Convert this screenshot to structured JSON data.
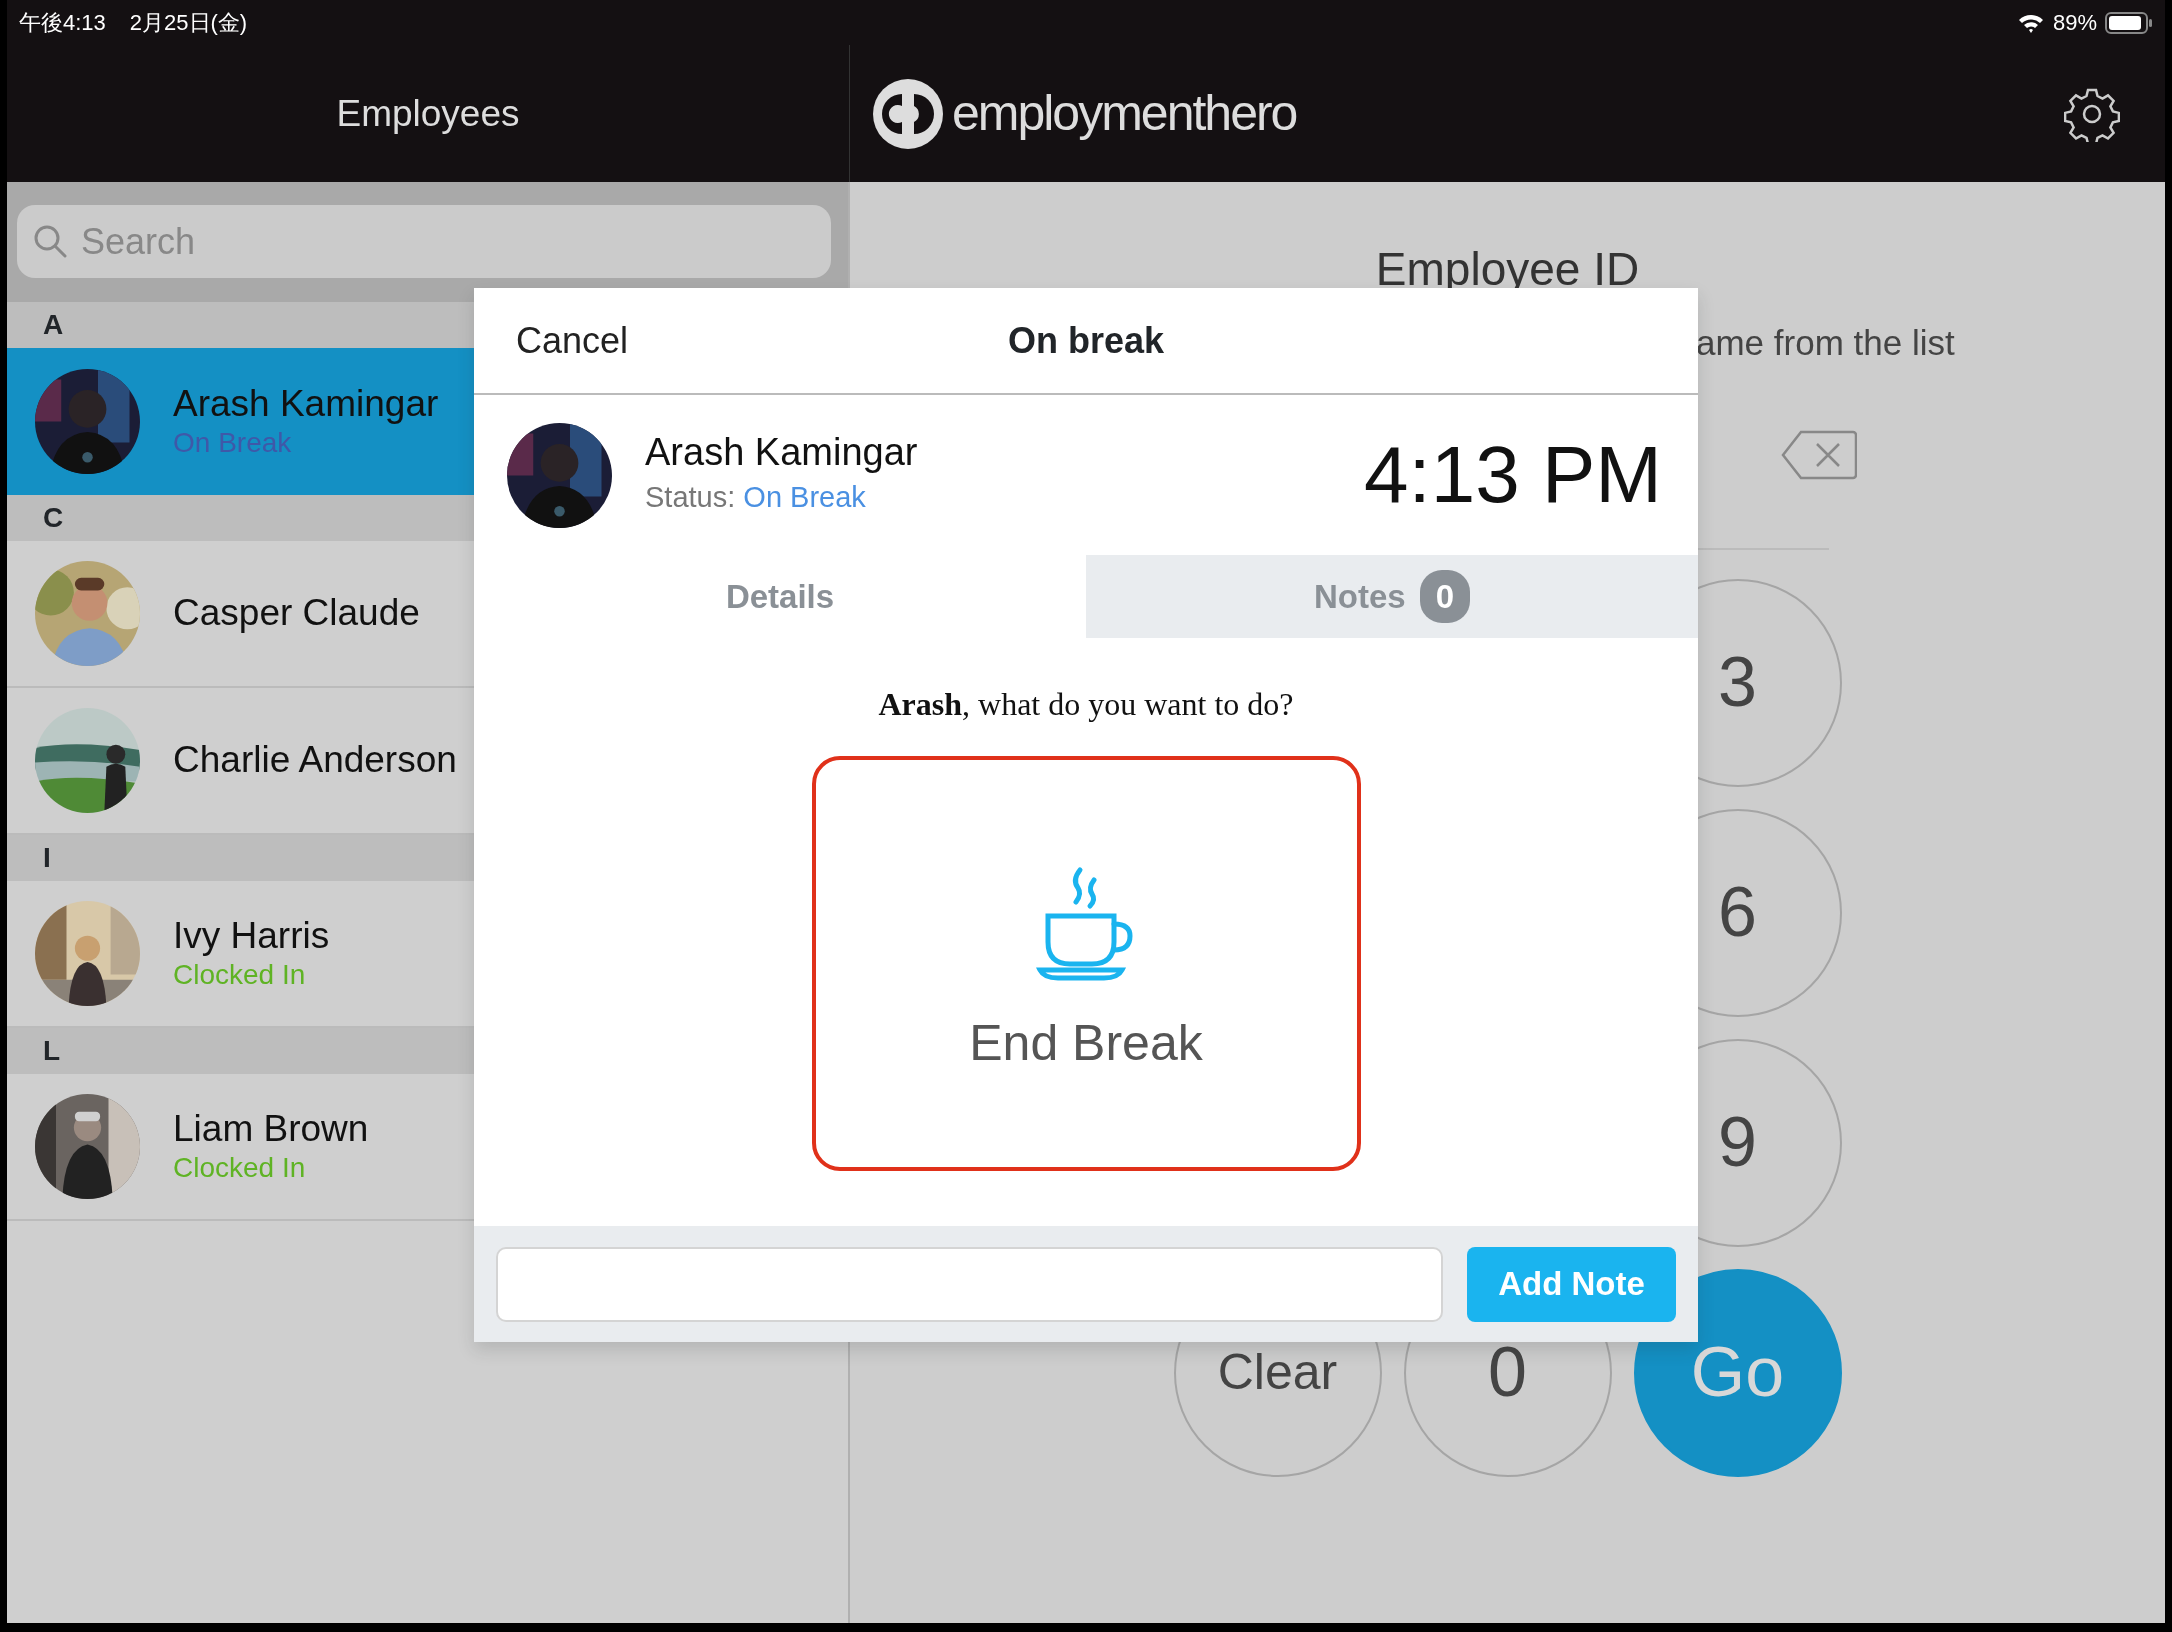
{
  "status_bar": {
    "time": "午後4:13",
    "date": "2月25日(金)",
    "battery": "89%"
  },
  "sidebar": {
    "title": "Employees",
    "search": {
      "placeholder": "Search"
    },
    "sections": [
      {
        "letter": "A",
        "employees": [
          {
            "name": "Arash Kamingar",
            "status": "On Break",
            "kind": "on_break",
            "selected": true
          }
        ]
      },
      {
        "letter": "C",
        "employees": [
          {
            "name": "Casper Claude",
            "selected": false
          },
          {
            "name": "Charlie Anderson",
            "selected": false
          }
        ]
      },
      {
        "letter": "I",
        "employees": [
          {
            "name": "Ivy Harris",
            "status": "Clocked In",
            "kind": "clocked_in",
            "selected": false
          }
        ]
      },
      {
        "letter": "L",
        "employees": [
          {
            "name": "Liam Brown",
            "status": "Clocked In",
            "kind": "clocked_in",
            "selected": false
          }
        ]
      }
    ]
  },
  "header": {
    "brand": "employmenthero"
  },
  "id_entry": {
    "title": "Employee ID",
    "hint": "ame from the list"
  },
  "keypad": {
    "right_column": [
      "3",
      "6",
      "9"
    ],
    "bottom_row": [
      {
        "label": "Clear",
        "kind": "plain"
      },
      {
        "label": "0",
        "kind": "plain"
      },
      {
        "label": "Go",
        "kind": "primary"
      }
    ]
  },
  "dialog": {
    "cancel": "Cancel",
    "title": "On break",
    "employee": {
      "name": "Arash Kamingar",
      "status_label": "Status:",
      "status": "On Break"
    },
    "time": "4:13 PM",
    "tabs": [
      {
        "label": "Details",
        "selected": true
      },
      {
        "label": "Notes",
        "selected": false,
        "badge": "0"
      }
    ],
    "prompt": "**Arash**, what do you want to do?",
    "action": {
      "label": "End Break",
      "highlighted": true
    },
    "note": {
      "button": "Add Note"
    }
  }
}
